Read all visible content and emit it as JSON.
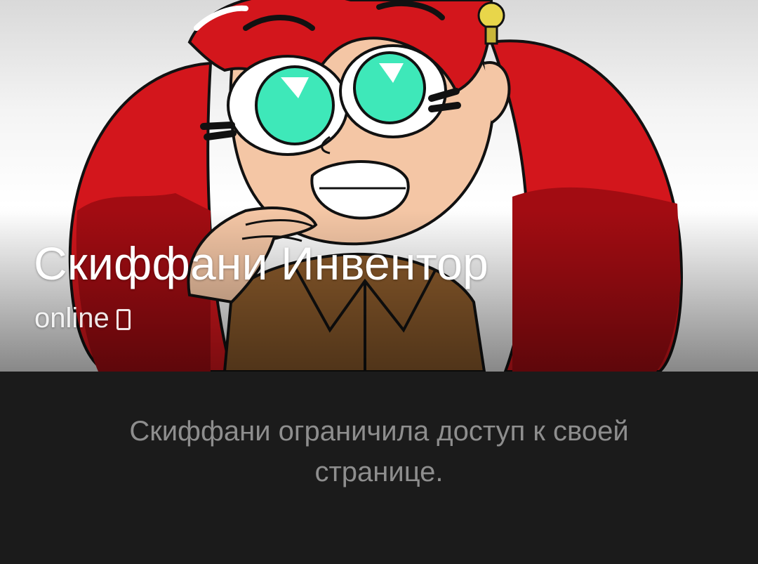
{
  "profile": {
    "name": "Скиффани Инвентор",
    "status": "online",
    "status_icon": "phone-icon",
    "cover_image": "avatar-cover-illustration"
  },
  "privacy": {
    "message": "Скиффани ограничила доступ к своей странице."
  },
  "colors": {
    "page_background": "#1b1b1b",
    "message_text": "#8e8e8e",
    "name_text": "#ffffff",
    "hair_red": "#d3161c",
    "eye_teal": "#3ee8b9"
  }
}
